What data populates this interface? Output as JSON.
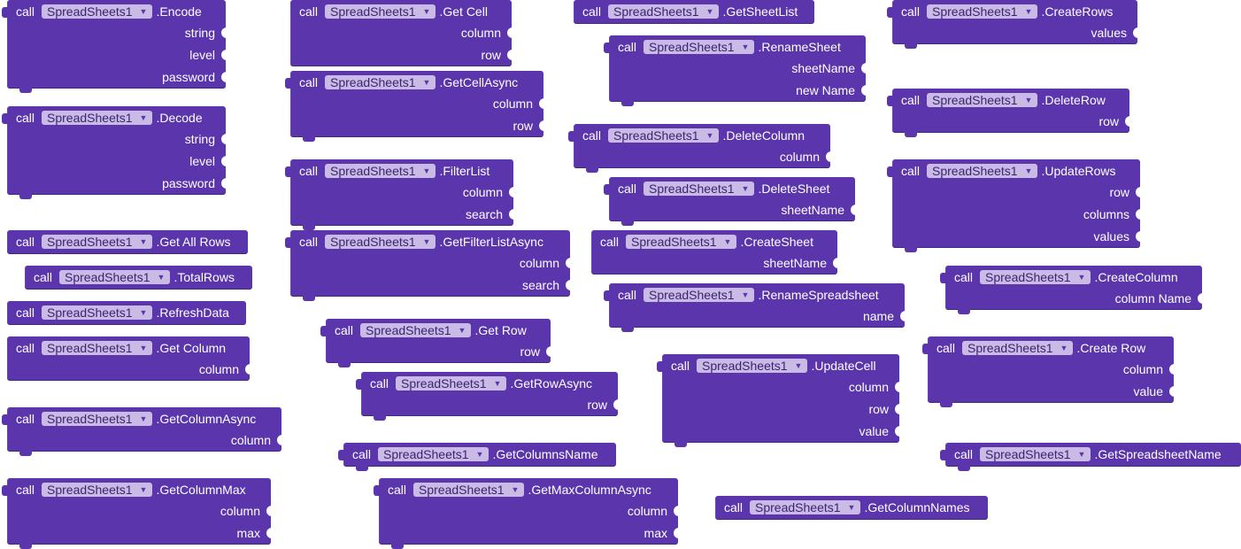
{
  "keyword": "call",
  "component": "SpreadSheets1",
  "blocks": [
    {
      "method": ".Encode",
      "args": [
        "string",
        "level",
        "password"
      ]
    },
    {
      "method": ".Decode",
      "args": [
        "string",
        "level",
        "password"
      ]
    },
    {
      "method": ".Get All Rows",
      "args": []
    },
    {
      "method": ".TotalRows",
      "args": []
    },
    {
      "method": ".RefreshData",
      "args": []
    },
    {
      "method": ".Get Column",
      "args": [
        "column"
      ]
    },
    {
      "method": ".GetColumnAsync",
      "args": [
        "column"
      ]
    },
    {
      "method": ".GetColumnMax",
      "args": [
        "column",
        "max"
      ]
    },
    {
      "method": ".Get Cell",
      "args": [
        "column",
        "row"
      ]
    },
    {
      "method": ".GetCellAsync",
      "args": [
        "column",
        "row"
      ]
    },
    {
      "method": ".FilterList",
      "args": [
        "column",
        "search"
      ]
    },
    {
      "method": ".GetFilterListAsync",
      "args": [
        "column",
        "search"
      ]
    },
    {
      "method": ".Get Row",
      "args": [
        "row"
      ]
    },
    {
      "method": ".GetRowAsync",
      "args": [
        "row"
      ]
    },
    {
      "method": ".GetColumnsName",
      "args": []
    },
    {
      "method": ".GetMaxColumnAsync",
      "args": [
        "column",
        "max"
      ]
    },
    {
      "method": ".GetSheetList",
      "args": []
    },
    {
      "method": ".RenameSheet",
      "args": [
        "sheetName",
        "new Name"
      ]
    },
    {
      "method": ".DeleteColumn",
      "args": [
        "column"
      ]
    },
    {
      "method": ".DeleteSheet",
      "args": [
        "sheetName"
      ]
    },
    {
      "method": ".CreateSheet",
      "args": [
        "sheetName"
      ]
    },
    {
      "method": ".RenameSpreadsheet",
      "args": [
        "name"
      ]
    },
    {
      "method": ".UpdateCell",
      "args": [
        "column",
        "row",
        "value"
      ]
    },
    {
      "method": ".GetColumnNames",
      "args": []
    },
    {
      "method": ".CreateRows",
      "args": [
        "values"
      ]
    },
    {
      "method": ".DeleteRow",
      "args": [
        "row"
      ]
    },
    {
      "method": ".UpdateRows",
      "args": [
        "row",
        "columns",
        "values"
      ]
    },
    {
      "method": ".CreateColumn",
      "args": [
        "column Name"
      ]
    },
    {
      "method": ".Create Row",
      "args": [
        "column",
        "value"
      ]
    },
    {
      "method": ".GetSpreadsheetName",
      "args": []
    }
  ],
  "colors": {
    "block": "#5b35ac",
    "dropdown": "#c9bbe6",
    "background": "#ffffff"
  }
}
